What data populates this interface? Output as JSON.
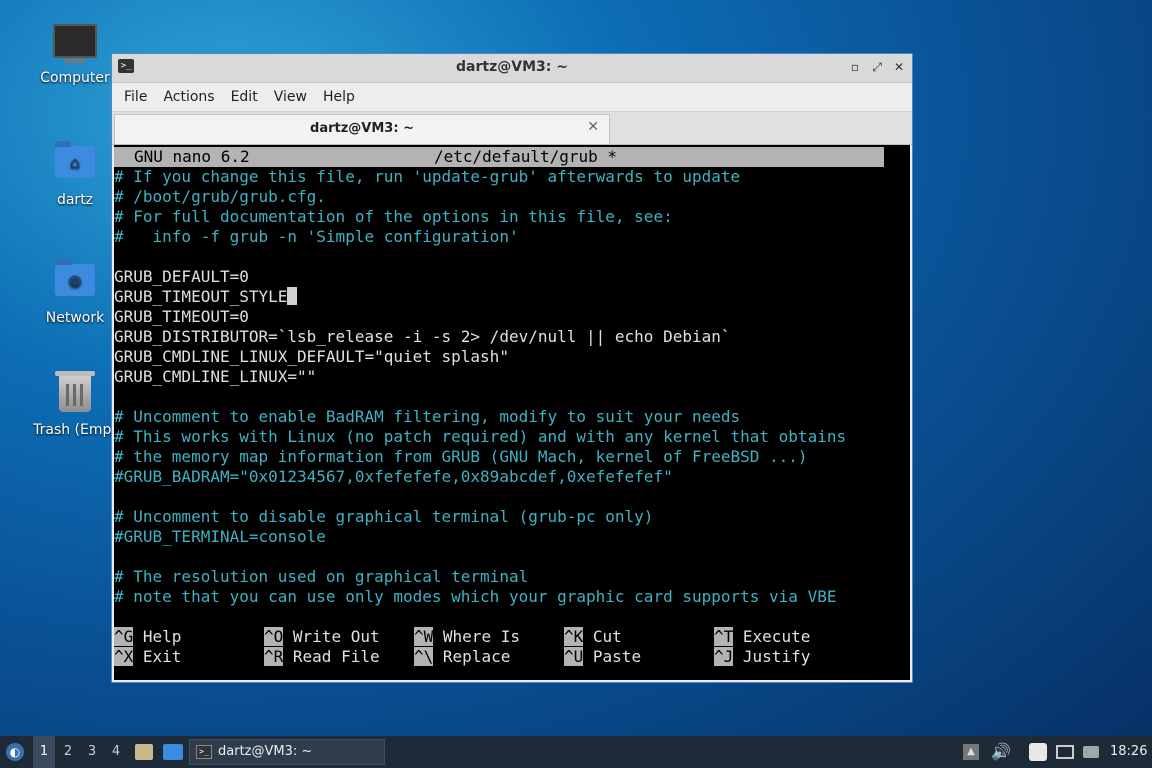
{
  "desktop": {
    "icons": [
      {
        "label": "Computer"
      },
      {
        "label": "dartz"
      },
      {
        "label": "Network"
      },
      {
        "label": "Trash (Empt"
      }
    ]
  },
  "window": {
    "title": "dartz@VM3: ~",
    "controls": {
      "minimize": "▫",
      "maximize": "⤢",
      "close": "✕"
    },
    "menu": [
      "File",
      "Actions",
      "Edit",
      "View",
      "Help"
    ],
    "tab": {
      "title": "dartz@VM3: ~",
      "close": "✕"
    }
  },
  "nano": {
    "version": "GNU nano 6.2",
    "filename": "/etc/default/grub *",
    "lines": [
      "# If you change this file, run 'update-grub' afterwards to update",
      "# /boot/grub/grub.cfg.",
      "# For full documentation of the options in this file, see:",
      "#   info -f grub -n 'Simple configuration'",
      "",
      "GRUB_DEFAULT=0",
      "GRUB_TIMEOUT_STYLE",
      "GRUB_TIMEOUT=0",
      "GRUB_DISTRIBUTOR=`lsb_release -i -s 2> /dev/null || echo Debian`",
      "GRUB_CMDLINE_LINUX_DEFAULT=\"quiet splash\"",
      "GRUB_CMDLINE_LINUX=\"\"",
      "",
      "# Uncomment to enable BadRAM filtering, modify to suit your needs",
      "# This works with Linux (no patch required) and with any kernel that obtains",
      "# the memory map information from GRUB (GNU Mach, kernel of FreeBSD ...)",
      "#GRUB_BADRAM=\"0x01234567,0xfefefefe,0x89abcdef,0xefefefef\"",
      "",
      "# Uncomment to disable graphical terminal (grub-pc only)",
      "#GRUB_TERMINAL=console",
      "",
      "# The resolution used on graphical terminal",
      "# note that you can use only modes which your graphic card supports via VBE"
    ],
    "shortcuts": [
      {
        "key": "^G",
        "label": "Help"
      },
      {
        "key": "^O",
        "label": "Write Out"
      },
      {
        "key": "^W",
        "label": "Where Is"
      },
      {
        "key": "^K",
        "label": "Cut"
      },
      {
        "key": "^T",
        "label": "Execute"
      },
      {
        "key": "^X",
        "label": "Exit"
      },
      {
        "key": "^R",
        "label": "Read File"
      },
      {
        "key": "^\\",
        "label": "Replace"
      },
      {
        "key": "^U",
        "label": "Paste"
      },
      {
        "key": "^J",
        "label": "Justify"
      }
    ]
  },
  "taskbar": {
    "workspaces": [
      "1",
      "2",
      "3",
      "4"
    ],
    "active_workspace": "1",
    "task": "dartz@VM3: ~",
    "clock": "18:26"
  }
}
